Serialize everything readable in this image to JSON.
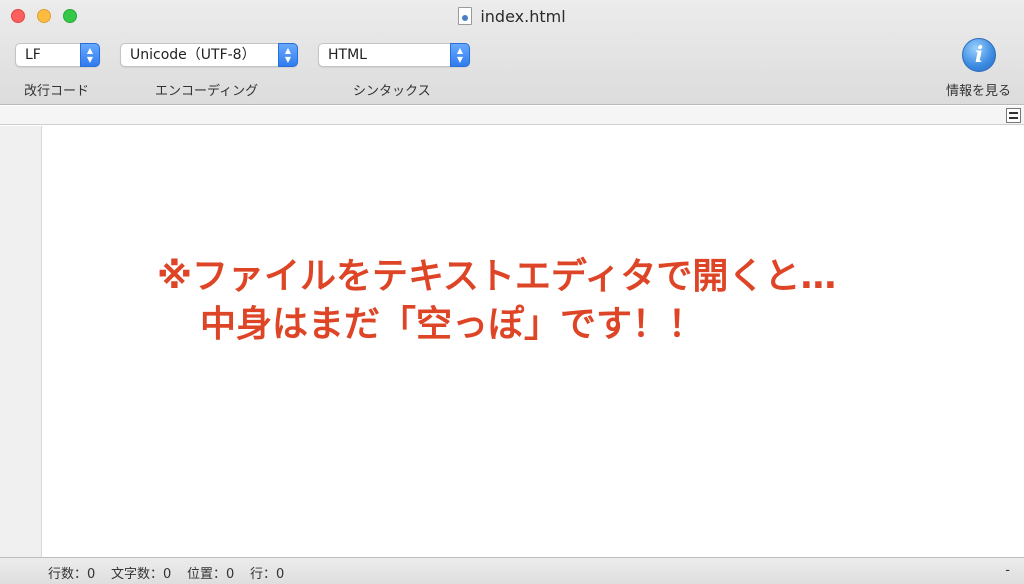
{
  "window": {
    "title": "index.html"
  },
  "toolbar": {
    "line_ending": {
      "value": "LF",
      "label": "改行コード"
    },
    "encoding": {
      "value": "Unicode（UTF-8）",
      "label": "エンコーディング"
    },
    "syntax": {
      "value": "HTML",
      "label": "シンタックス"
    },
    "info": {
      "glyph": "i",
      "label": "情報を見る"
    }
  },
  "editor": {
    "annotation_line1": "※ファイルをテキストエディタで開くと…",
    "annotation_line2": "中身はまだ「空っぽ」です！！",
    "annotation_color": "#dd4526"
  },
  "status_bar": {
    "lines": "行数：0",
    "chars": "文字数：0",
    "position": "位置：0",
    "row": "行：0",
    "right": "-"
  },
  "icons": {
    "close": "close-button",
    "minimize": "minimize-button",
    "zoom": "zoom-button",
    "document": "document-icon",
    "info": "info-icon",
    "split": "split-editor-icon"
  }
}
